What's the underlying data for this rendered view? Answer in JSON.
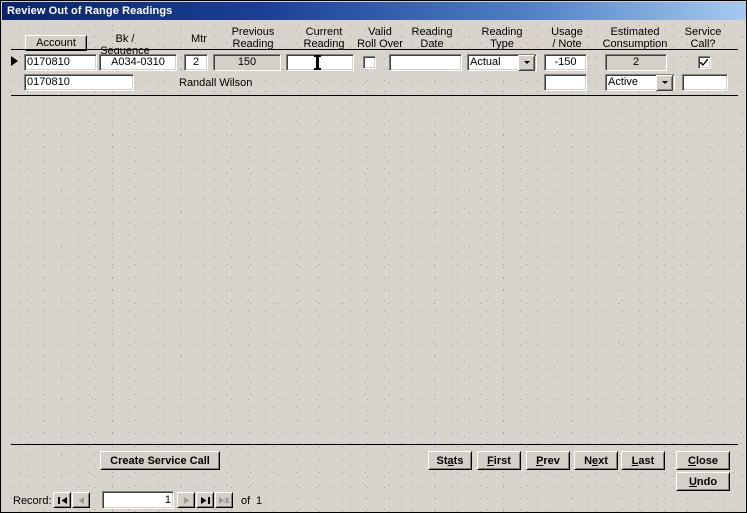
{
  "window": {
    "title": "Review Out of Range Readings"
  },
  "grid": {
    "headers": [
      {
        "key": "account",
        "label": "Account"
      },
      {
        "key": "bkseq",
        "label": "Bk / Sequence"
      },
      {
        "key": "mtr",
        "label": "Mtr"
      },
      {
        "key": "prev",
        "label": "Previous\nReading"
      },
      {
        "key": "curr",
        "label": "Current\nReading"
      },
      {
        "key": "rollover",
        "label": "Valid\nRoll Over"
      },
      {
        "key": "date",
        "label": "Reading\nDate"
      },
      {
        "key": "type",
        "label": "Reading\nType"
      },
      {
        "key": "usage",
        "label": "Usage\n/ Note"
      },
      {
        "key": "estimated",
        "label": "Estimated\nConsumption"
      },
      {
        "key": "service",
        "label": "Service\nCall?"
      }
    ],
    "row": {
      "account": "0170810",
      "bk_sequence": "A034-0310",
      "mtr": "2",
      "previous_reading": "150",
      "current_reading": "",
      "valid_roll_over_checked": false,
      "reading_date": "",
      "reading_type": "Actual",
      "usage_note": "-150",
      "estimated_consumption": "2",
      "service_call_checked": true
    },
    "subrow": {
      "account": "0170810",
      "customer_name": "Randall Wilson",
      "note": "",
      "status": "Active",
      "extra": ""
    }
  },
  "actions": {
    "account_button": "Account",
    "create_service_call": "Create Service Call",
    "stats": "Stats",
    "first": "First",
    "prev": "Prev",
    "next": "Next",
    "last": "Last",
    "close": "Close",
    "undo": "Undo"
  },
  "accelerators": {
    "stats": "a",
    "first": "F",
    "prev": "P",
    "next": "e",
    "last": "L",
    "close": "C",
    "undo": "U"
  },
  "navigator": {
    "record_label": "Record:",
    "current": "1",
    "of_label": "of",
    "total": "1",
    "buttons": [
      {
        "name": "first-record-button",
        "icon": "first-record-icon",
        "enabled": true
      },
      {
        "name": "previous-record-button",
        "icon": "previous-record-icon",
        "enabled": false
      },
      {
        "name": "next-record-button",
        "icon": "next-record-icon",
        "enabled": false
      },
      {
        "name": "last-record-button",
        "icon": "last-record-icon",
        "enabled": true
      },
      {
        "name": "new-record-button",
        "icon": "new-record-icon",
        "enabled": false
      }
    ]
  },
  "colors": {
    "titlebar_start": "#0a246a",
    "titlebar_end": "#a6caf0",
    "form_background": "#d8d4cc",
    "dot_pattern": "#8fa2c4",
    "control_face": "#d4d0c8",
    "field_background": "#ffffff",
    "disabled_field": "#d4d0c8"
  }
}
